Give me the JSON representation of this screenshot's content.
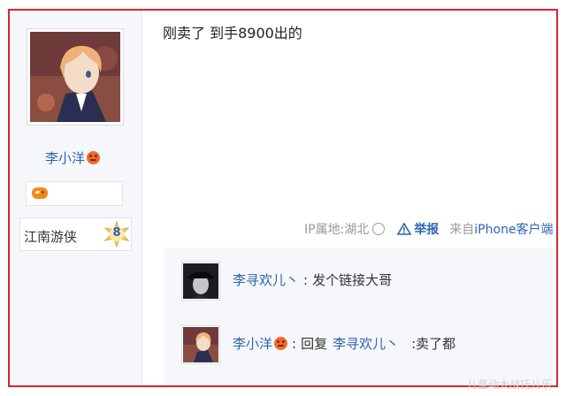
{
  "author": {
    "avatar_icon": "anime-avatar",
    "name": "李小洋",
    "mood_icon": "angry-face-icon",
    "game_icon": "gamepad-icon",
    "level_title": "江南游侠",
    "level_number": "8"
  },
  "post": {
    "content": "刚卖了 到手8900出的",
    "ip_location": "IP属地:湖北",
    "report_label": "举报",
    "source_prefix": "来自",
    "source_device": "iPhone客户端"
  },
  "comments": [
    {
      "user": "李寻欢儿丶",
      "separator": ":",
      "text": "发个链接大哥"
    },
    {
      "user": "李小洋",
      "separator": ":",
      "reply_prefix": "回复",
      "reply_to": "李寻欢儿丶",
      "text": ":卖了都"
    }
  ],
  "watermark": "儿童动大战托儿乐",
  "colors": {
    "frame": "#d9262c",
    "link": "#2d64b3",
    "meta": "#999999",
    "panel": "#f5f7fa"
  }
}
